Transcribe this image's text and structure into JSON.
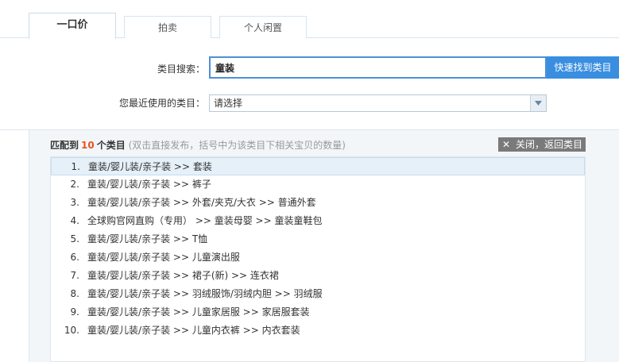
{
  "tabs": [
    {
      "label": "一口价",
      "active": true
    },
    {
      "label": "拍卖",
      "active": false
    },
    {
      "label": "个人闲置",
      "active": false
    }
  ],
  "search": {
    "label": "类目搜索：",
    "value": "童装",
    "button_label": "快速找到类目"
  },
  "recent": {
    "label": "您最近使用的类目：",
    "selected": "请选择"
  },
  "results": {
    "prefix": "匹配到",
    "count": "10",
    "suffix": "个类目",
    "hint": "(双击直接发布，括号中为该类目下相关宝贝的数量)",
    "close_label": "关闭，返回类目",
    "items": [
      {
        "num": "1.",
        "path": "童装/婴儿装/亲子装 >> 套装"
      },
      {
        "num": "2.",
        "path": "童装/婴儿装/亲子装 >> 裤子"
      },
      {
        "num": "3.",
        "path": "童装/婴儿装/亲子装 >> 外套/夹克/大衣 >> 普通外套"
      },
      {
        "num": "4.",
        "path": "全球购官网直购（专用） >> 童装母婴 >> 童装童鞋包"
      },
      {
        "num": "5.",
        "path": "童装/婴儿装/亲子装 >> T恤"
      },
      {
        "num": "6.",
        "path": "童装/婴儿装/亲子装 >> 儿童演出服"
      },
      {
        "num": "7.",
        "path": "童装/婴儿装/亲子装 >> 裙子(新) >> 连衣裙"
      },
      {
        "num": "8.",
        "path": "童装/婴儿装/亲子装 >> 羽绒服饰/羽绒内胆 >> 羽绒服"
      },
      {
        "num": "9.",
        "path": "童装/婴儿装/亲子装 >> 儿童家居服 >> 家居服套装"
      },
      {
        "num": "10.",
        "path": "童装/婴儿装/亲子装 >> 儿童内衣裤 >> 内衣套装"
      }
    ]
  },
  "colors": {
    "accent": "#3a8ee0",
    "count": "#e8541e",
    "selected_row": "#e5f0f8"
  }
}
